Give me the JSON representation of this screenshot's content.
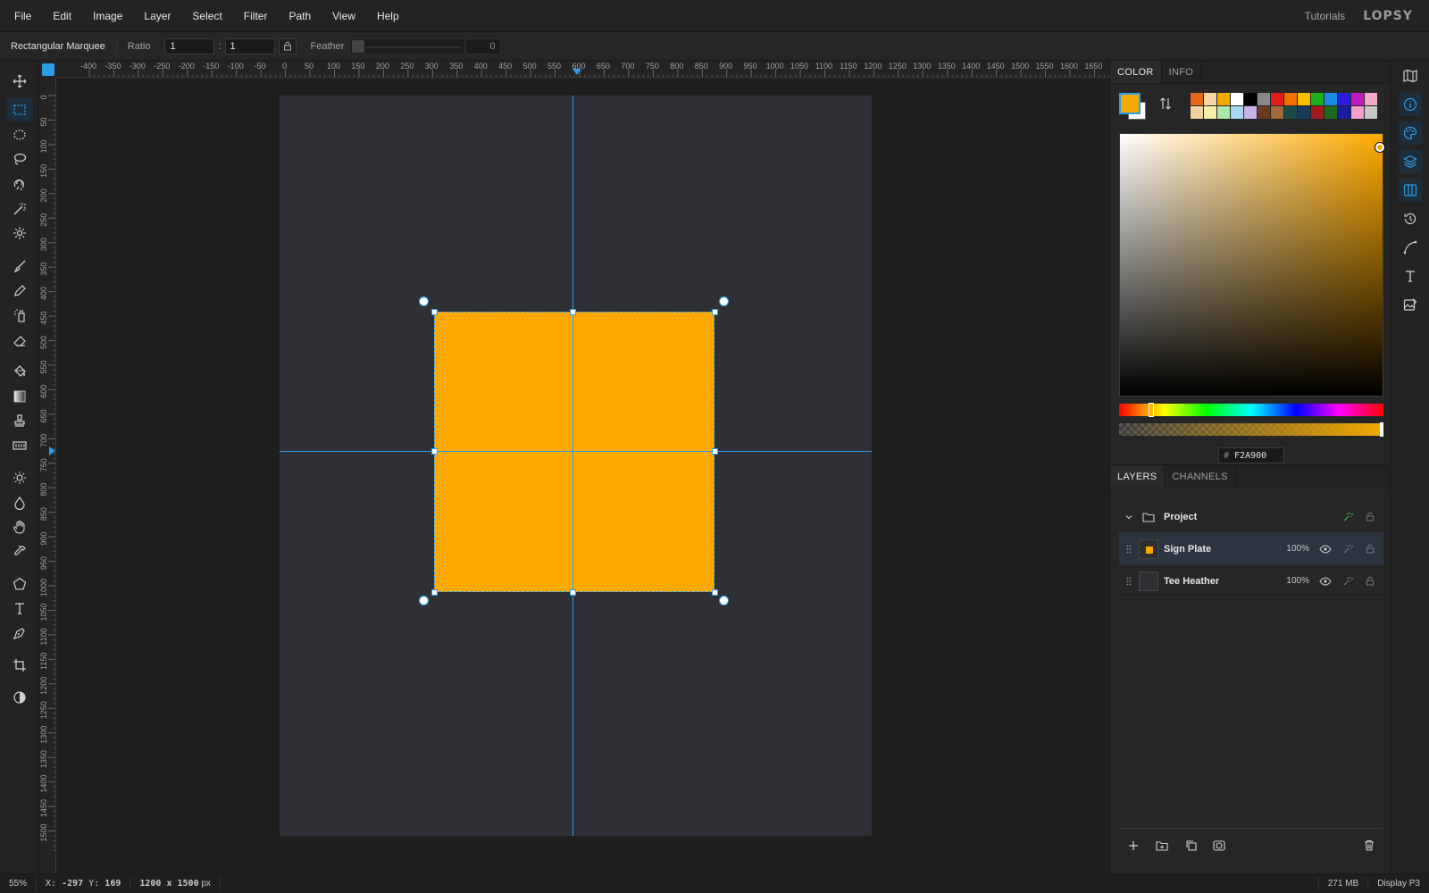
{
  "menu": [
    "File",
    "Edit",
    "Image",
    "Layer",
    "Select",
    "Filter",
    "Path",
    "View",
    "Help"
  ],
  "header": {
    "tutorials": "Tutorials",
    "logo": "LOPSY"
  },
  "options": {
    "tool_name": "Rectangular Marquee",
    "ratio_label": "Ratio",
    "ratio_w": "1",
    "ratio_sep": ":",
    "ratio_h": "1",
    "feather_label": "Feather",
    "feather_value": "0"
  },
  "ruler_h_labels": [
    "-400",
    "-350",
    "-300",
    "-250",
    "-200",
    "-150",
    "-100",
    "-50",
    "0",
    "50",
    "100",
    "150",
    "200",
    "250",
    "300",
    "350",
    "400",
    "450",
    "500",
    "550",
    "600",
    "650",
    "700",
    "750",
    "800",
    "850",
    "900",
    "950",
    "1000",
    "1050",
    "1100",
    "1150",
    "1200",
    "1250",
    "1300",
    "1350",
    "1400",
    "1450",
    "1500",
    "1550",
    "1600",
    "1650"
  ],
  "ruler_v_labels": [
    "0",
    "50",
    "100",
    "150",
    "200",
    "250",
    "300",
    "350",
    "400",
    "450",
    "500",
    "550",
    "600",
    "650",
    "700",
    "750",
    "800",
    "850",
    "900",
    "950",
    "1000",
    "1050",
    "1100",
    "1150",
    "1200",
    "1250",
    "1300",
    "1350",
    "1400",
    "1450",
    "1500"
  ],
  "tools": [
    {
      "name": "move-tool",
      "icon": "move-icon",
      "active": false
    },
    {
      "name": "rect-marquee-tool",
      "icon": "rect-marquee-icon",
      "active": true
    },
    {
      "name": "ellipse-marquee-tool",
      "icon": "ellipse-marquee-icon",
      "active": false
    },
    {
      "name": "lasso-tool",
      "icon": "lasso-icon",
      "active": false
    },
    {
      "name": "magnetic-lasso-tool",
      "icon": "magnetic-lasso-icon",
      "active": false
    },
    {
      "name": "magic-wand-tool",
      "icon": "magic-wand-icon",
      "active": false
    },
    {
      "name": "quick-select-tool",
      "icon": "quick-select-icon",
      "active": false
    },
    {
      "name": "brush-tool",
      "icon": "brush-icon",
      "active": false
    },
    {
      "name": "pencil-tool",
      "icon": "pencil-icon",
      "active": false
    },
    {
      "name": "spray-tool",
      "icon": "spray-icon",
      "active": false
    },
    {
      "name": "eraser-tool",
      "icon": "eraser-icon",
      "active": false
    },
    {
      "name": "bucket-tool",
      "icon": "bucket-icon",
      "active": false
    },
    {
      "name": "gradient-tool",
      "icon": "gradient-icon",
      "active": false
    },
    {
      "name": "stamp-tool",
      "icon": "stamp-icon",
      "active": false
    },
    {
      "name": "pattern-tool",
      "icon": "pattern-icon",
      "active": false
    },
    {
      "name": "dodge-tool",
      "icon": "sun-icon",
      "active": false
    },
    {
      "name": "blur-tool",
      "icon": "drop-icon",
      "active": false
    },
    {
      "name": "hand-tool",
      "icon": "hand-icon",
      "active": false
    },
    {
      "name": "eyedropper-tool",
      "icon": "eyedropper-icon",
      "active": false
    },
    {
      "name": "shape-tool",
      "icon": "pentagon-icon",
      "active": false
    },
    {
      "name": "text-tool",
      "icon": "text-icon",
      "active": false
    },
    {
      "name": "pen-tool",
      "icon": "pen-icon",
      "active": false
    },
    {
      "name": "crop-tool",
      "icon": "crop-icon",
      "active": false
    },
    {
      "name": "contrast-tool",
      "icon": "contrast-icon",
      "active": false
    }
  ],
  "color_panel": {
    "tabs": [
      "COLOR",
      "INFO"
    ],
    "active_tab": "COLOR",
    "foreground": "#F2A900",
    "background": "#FFFFFF",
    "hex_prefix": "#",
    "hex_value": "F2A900",
    "palette": [
      "#e8661c",
      "#f5d8a8",
      "#f2a900",
      "#ffffff",
      "#000000",
      "#888888",
      "#e01c1c",
      "#f07000",
      "#f5c000",
      "#1cb01c",
      "#1c8ce0",
      "#2c1ce0",
      "#c01cc0",
      "#f5a8c8",
      "#f5d0a0",
      "#f5f0a8",
      "#a8e8a8",
      "#a8d8f0",
      "#c8b0e8",
      "#6a3a1c",
      "#a06a3a",
      "#1c4a4a",
      "#1c3a5a",
      "#a01c1c",
      "#1c6a1c",
      "#1c1ca0",
      "#f5a0c8",
      "#c8c8c8"
    ]
  },
  "layers_panel": {
    "tabs": [
      "LAYERS",
      "CHANNELS"
    ],
    "active_tab": "LAYERS",
    "group": {
      "name": "Project"
    },
    "layers": [
      {
        "name": "Sign Plate",
        "opacity": "100%",
        "selected": true,
        "has_content": true
      },
      {
        "name": "Tee Heather",
        "opacity": "100%",
        "selected": false,
        "has_content": false
      }
    ]
  },
  "rail": [
    {
      "name": "navigator",
      "icon": "map-icon",
      "active": false
    },
    {
      "name": "info",
      "icon": "info-icon",
      "active": true
    },
    {
      "name": "color",
      "icon": "palette-icon",
      "active": true
    },
    {
      "name": "layers",
      "icon": "layers-icon",
      "active": true
    },
    {
      "name": "channels",
      "icon": "columns-icon",
      "active": true
    },
    {
      "name": "history",
      "icon": "history-icon",
      "active": false
    },
    {
      "name": "paths",
      "icon": "curve-icon",
      "active": false
    },
    {
      "name": "character",
      "icon": "text-icon",
      "active": false
    },
    {
      "name": "image-properties",
      "icon": "image-edit-icon",
      "active": false
    }
  ],
  "status": {
    "zoom": "55%",
    "x_label": "X:",
    "x_value": "-297",
    "y_label": "Y:",
    "y_value": "169",
    "doc_size": "1200 x 1500",
    "doc_unit": "px",
    "memory": "271 MB",
    "color_profile": "Display P3"
  },
  "accent_color": "#2C9EE8",
  "layer_fill_color": "#FFA800"
}
